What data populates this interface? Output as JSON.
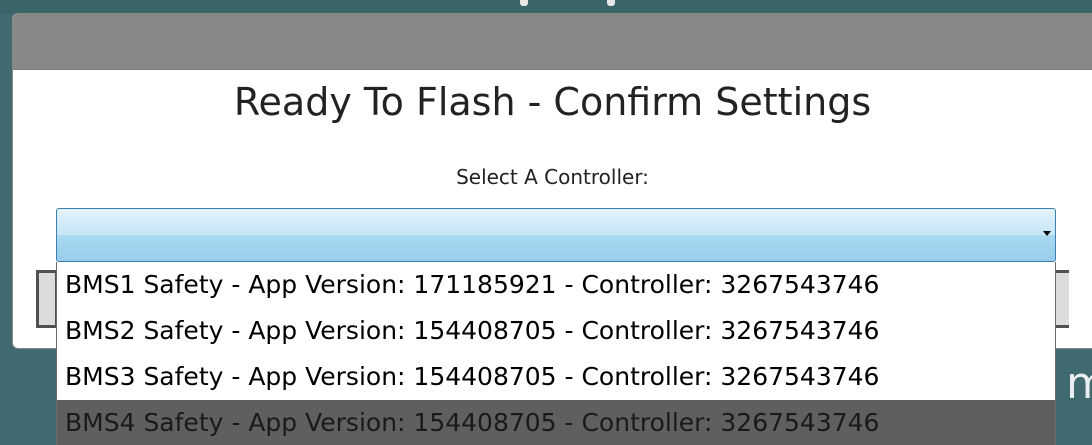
{
  "dialog": {
    "title": "Ready To Flash - Confirm Settings",
    "subtitle": "Select A Controller:"
  },
  "combo": {
    "selected_value": ""
  },
  "dropdown": {
    "items": [
      {
        "label": "BMS1 Safety - App Version:  171185921 - Controller: 3267543746"
      },
      {
        "label": "BMS2 Safety - App Version:  154408705 - Controller: 3267543746"
      },
      {
        "label": "BMS3 Safety - App Version:  154408705 - Controller: 3267543746"
      },
      {
        "label": "BMS4 Safety - App Version:  154408705 - Controller: 3267543746"
      }
    ],
    "highlighted_index": 3
  },
  "background": {
    "edge_text": "m"
  },
  "colors": {
    "titlebar": "#888888",
    "combo_border": "#3c7fb1",
    "highlight": "#5f5f5f",
    "background": "#3f6b70"
  },
  "icons": {
    "combo_arrow": "chevron-down-icon"
  }
}
